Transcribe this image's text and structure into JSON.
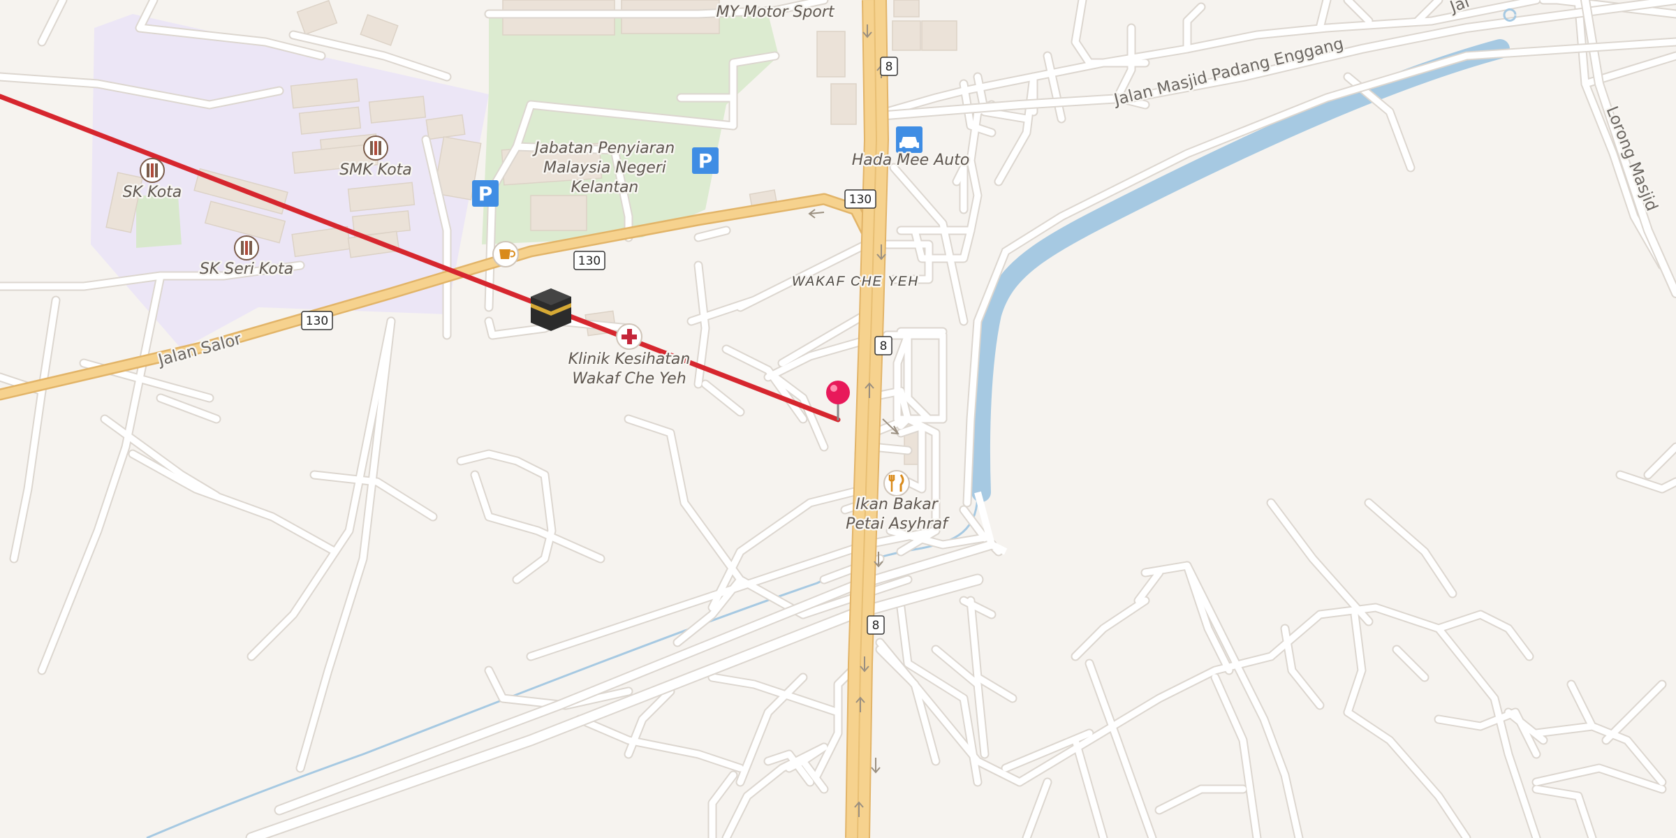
{
  "map": {
    "colors": {
      "background": "#f6f3ef",
      "minor_road": "#ffffff",
      "minor_road_casing": "#dcd6cf",
      "major_road": "#f5d08a",
      "major_road_casing": "#e0b060",
      "school_area": "#eae4f4",
      "park": "#d8e8cc",
      "river": "#a8cce4",
      "route_line": "#d6262e",
      "pin": "#e8195a",
      "parking": "#3f8de4"
    },
    "route_line": "straight red route line",
    "pin": "destination-pin",
    "kaaba": "kaaba-icon",
    "pois": [
      {
        "id": "sk-kota",
        "label": "SK Kota",
        "icon": "school-icon"
      },
      {
        "id": "smk-kota",
        "label": "SMK Kota",
        "icon": "school-icon"
      },
      {
        "id": "sk-seri-kota",
        "label": "SK Seri Kota",
        "icon": "school-icon"
      },
      {
        "id": "jabatan",
        "lines": [
          "Jabatan Penyiaran",
          "Malaysia Negeri",
          "Kelantan"
        ]
      },
      {
        "id": "my-motor",
        "label": "MY Motor Sport"
      },
      {
        "id": "hada-mee",
        "label": "Hada Mee Auto",
        "icon": "car-icon"
      },
      {
        "id": "klinik",
        "lines": [
          "Klinik Kesihatan",
          "Wakaf Che Yeh"
        ],
        "icon": "clinic-cross-icon"
      },
      {
        "id": "ikan-bakar",
        "lines": [
          "Ikan Bakar",
          "Petai Asyhraf"
        ],
        "icon": "restaurant-icon"
      },
      {
        "id": "cafe",
        "icon": "cafe-icon"
      },
      {
        "id": "parking-1",
        "label": "P",
        "icon": "parking-icon"
      },
      {
        "id": "parking-2",
        "label": "P",
        "icon": "parking-icon"
      }
    ],
    "district": "WAKAF CHE YEH",
    "roads": {
      "jalan_salor": "Jalan Salor",
      "jalan_masjid": "Jalan Masjid Padang Enggang",
      "lorong_masjid": "Lorong Masjid",
      "partial_top_right": "Jal"
    },
    "shields": {
      "route_130": "130",
      "route_8": "8"
    }
  }
}
